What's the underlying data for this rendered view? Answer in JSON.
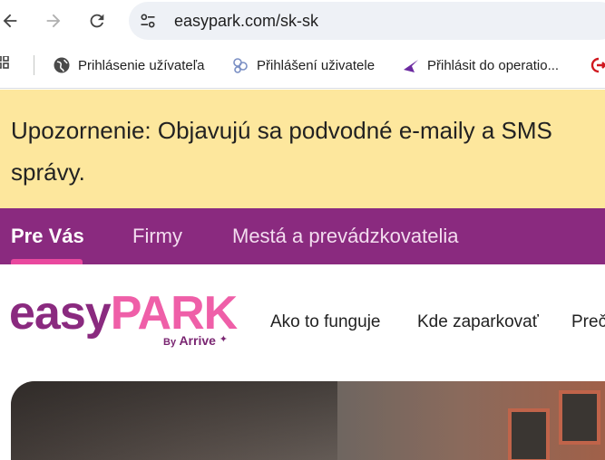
{
  "browser": {
    "url": "easypark.com/sk-sk",
    "bookmarks": [
      {
        "label": "Prihlásenie užívateľa",
        "icon": "globe-icon"
      },
      {
        "label": "Přihlášení uživatele",
        "icon": "cluster-icon"
      },
      {
        "label": "Přihlásit do operatio...",
        "icon": "plane-icon"
      }
    ]
  },
  "notice": {
    "text": "Upozornenie: Objavujú sa podvodné e-maily a SMS správy."
  },
  "audience_nav": {
    "items": [
      {
        "label": "Pre Vás",
        "active": true
      },
      {
        "label": "Firmy"
      },
      {
        "label": "Mestá a prevádzkovatelia"
      }
    ]
  },
  "header": {
    "logo": {
      "part1": "easy",
      "part2": "PARK",
      "by": "By",
      "brand": "Arrive"
    },
    "nav": [
      {
        "label": "Ako to funguje"
      },
      {
        "label": "Kde zaparkovať"
      },
      {
        "label": "Preč"
      }
    ]
  },
  "colors": {
    "notice_bg": "#fde79d",
    "brand_purple": "#8a2a7f",
    "brand_pink": "#ef5fa8",
    "active_indicator": "#e9489e"
  }
}
